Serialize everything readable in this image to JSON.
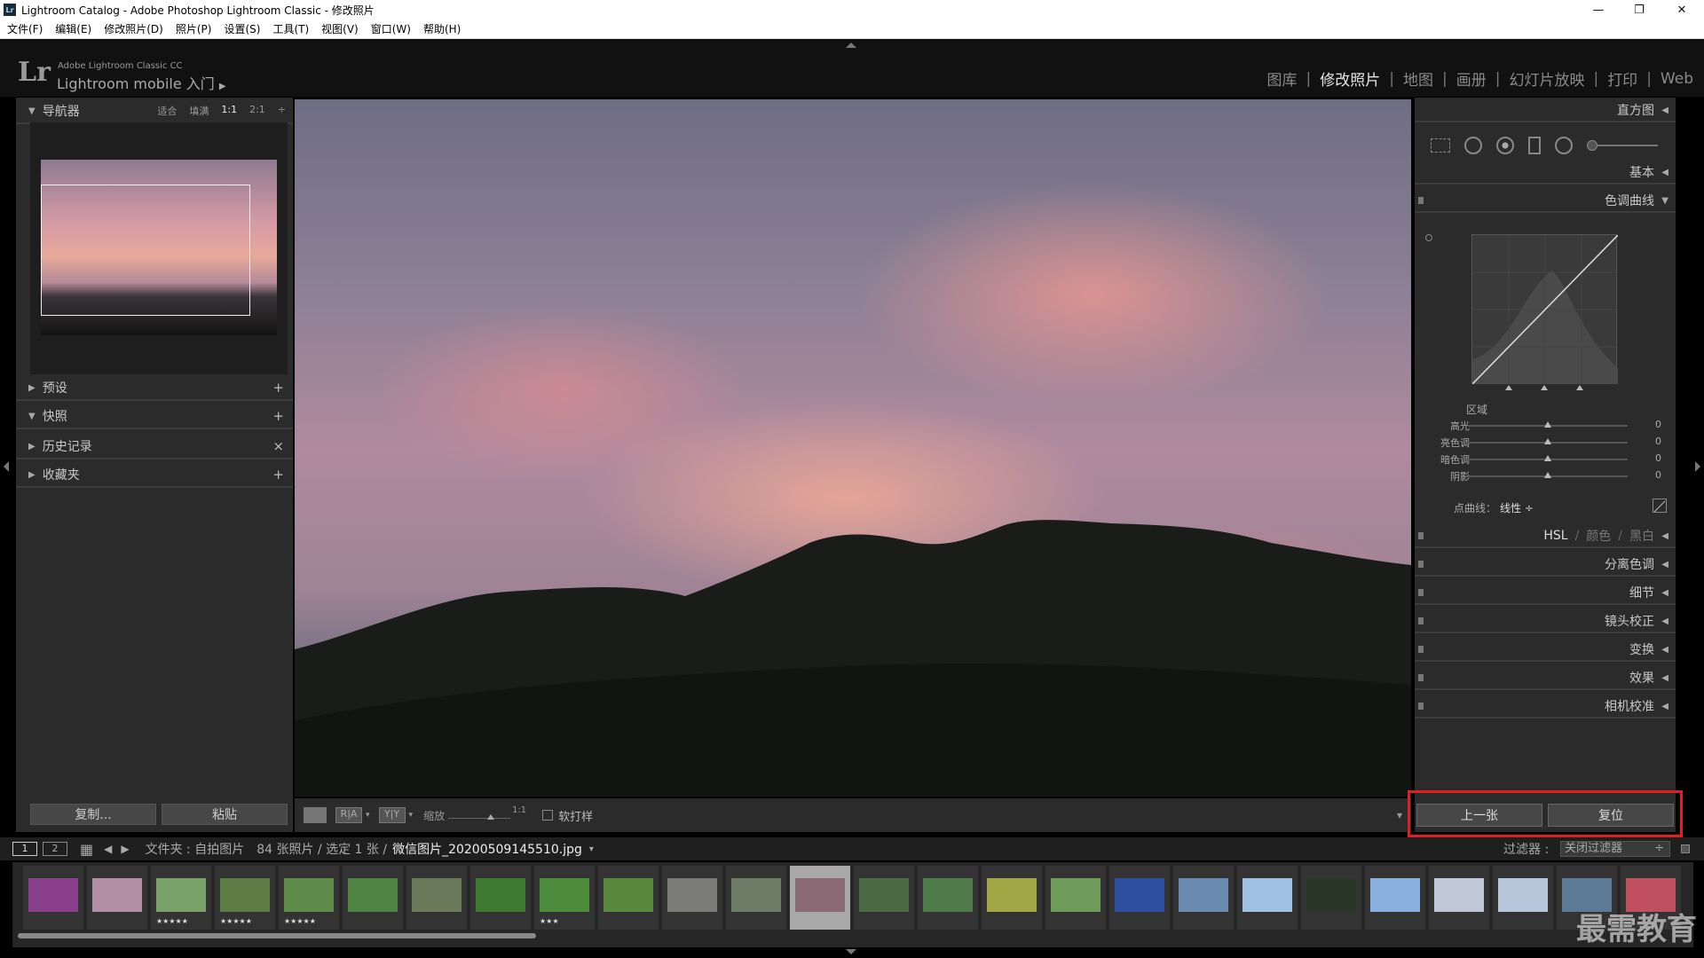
{
  "window": {
    "title": "Lightroom Catalog - Adobe Photoshop Lightroom Classic - 修改照片",
    "app_icon": "Lr",
    "minimize": "—",
    "maximize": "❐",
    "close": "✕"
  },
  "menu": [
    "文件(F)",
    "编辑(E)",
    "修改照片(D)",
    "照片(P)",
    "设置(S)",
    "工具(T)",
    "视图(V)",
    "窗口(W)",
    "帮助(H)"
  ],
  "header": {
    "logo": "Lr",
    "product": "Adobe Lightroom Classic CC",
    "mobile": "Lightroom mobile 入门",
    "mobile_arrow": "▶",
    "modules": [
      {
        "label": "图库",
        "active": false
      },
      {
        "label": "修改照片",
        "active": true
      },
      {
        "label": "地图",
        "active": false
      },
      {
        "label": "画册",
        "active": false
      },
      {
        "label": "幻灯片放映",
        "active": false
      },
      {
        "label": "打印",
        "active": false
      },
      {
        "label": "Web",
        "active": false
      }
    ],
    "separator": "|"
  },
  "left_panel": {
    "navigator": {
      "label": "导航器",
      "options": [
        "适合",
        "填满",
        "1:1",
        "2:1"
      ],
      "options_arrow": "÷"
    },
    "sections": [
      {
        "label": "预设",
        "action": "+"
      },
      {
        "label": "快照",
        "action": "+"
      },
      {
        "label": "历史记录",
        "action": "×"
      },
      {
        "label": "收藏夹",
        "action": "+"
      }
    ],
    "copy_button": "复制...",
    "paste_button": "粘贴"
  },
  "toolbar": {
    "zoom_label": "缩放",
    "zoom_value": "1:1",
    "softproof_label": "软打样",
    "view_ra": "R|A",
    "view_yy": "Y|Y",
    "dropdown_arrow": "▾"
  },
  "right_panel": {
    "histogram": "直方图",
    "basic": "基本",
    "tone_curve": "色调曲线",
    "region_label": "区域",
    "sliders": [
      {
        "label": "高光",
        "value": "0"
      },
      {
        "label": "亮色调",
        "value": "0"
      },
      {
        "label": "暗色调",
        "value": "0"
      },
      {
        "label": "阴影",
        "value": "0"
      }
    ],
    "point_curve_label": "点曲线：",
    "point_curve_value": "线性 ÷",
    "hsl_tabs": [
      "HSL",
      "颜色",
      "黑白"
    ],
    "hsl_sep": "/",
    "sections": [
      "分离色调",
      "细节",
      "镜头校正",
      "变换",
      "效果",
      "相机校准"
    ],
    "collapse_arrow": "◀",
    "expand_arrow": "▼",
    "prev_button": "上一张",
    "reset_button": "复位"
  },
  "filmstrip_bar": {
    "screen1": "1",
    "screen2": "2",
    "grid_icon": "▦",
    "back": "◀",
    "forward": "▶",
    "path": "文件夹 : 自拍图片",
    "count": "84 张照片 / 选定 1 张 /",
    "filename": "微信图片_20200509145510.jpg",
    "filename_arrow": "▾",
    "filter_label": "过滤器 :",
    "filter_value": "关闭过滤器",
    "filter_arrow": "÷"
  },
  "filmstrip": [
    {
      "stars": "",
      "color": "#8a3f8c"
    },
    {
      "stars": "",
      "color": "#b08fa6"
    },
    {
      "stars": "★★★★★",
      "color": "#7aa06a"
    },
    {
      "stars": "★★★★★",
      "color": "#5d7c45"
    },
    {
      "stars": "★★★★★",
      "color": "#5e8a4a"
    },
    {
      "stars": "",
      "color": "#4f8344"
    },
    {
      "stars": "",
      "color": "#6b7a5a"
    },
    {
      "stars": "",
      "color": "#3e7a30"
    },
    {
      "stars": "★★★",
      "color": "#4c8c3c"
    },
    {
      "stars": "",
      "color": "#58873e"
    },
    {
      "stars": "",
      "color": "#7b7b78"
    },
    {
      "stars": "",
      "color": "#6d7c66"
    },
    {
      "stars": "",
      "color": "#8a6a74"
    },
    {
      "stars": "",
      "color": "#4b6a44"
    },
    {
      "stars": "",
      "color": "#4d7a48"
    },
    {
      "stars": "",
      "color": "#a3a645"
    },
    {
      "stars": "",
      "color": "#6e9a5a"
    },
    {
      "stars": "",
      "color": "#2e4fa0"
    },
    {
      "stars": "",
      "color": "#6a8ab0"
    },
    {
      "stars": "",
      "color": "#9fc0e0"
    },
    {
      "stars": "",
      "color": "#2a3628"
    },
    {
      "stars": "",
      "color": "#8ab0e0"
    },
    {
      "stars": "",
      "color": "#c0c8d8"
    },
    {
      "stars": "",
      "color": "#b8c6dc"
    },
    {
      "stars": "",
      "color": "#5c7a96"
    },
    {
      "stars": "",
      "color": "#c05060"
    }
  ],
  "watermark": "最需教育",
  "colors": {
    "highlight": "#e02020",
    "panel": "#2b2b2b",
    "background": "#111111"
  }
}
